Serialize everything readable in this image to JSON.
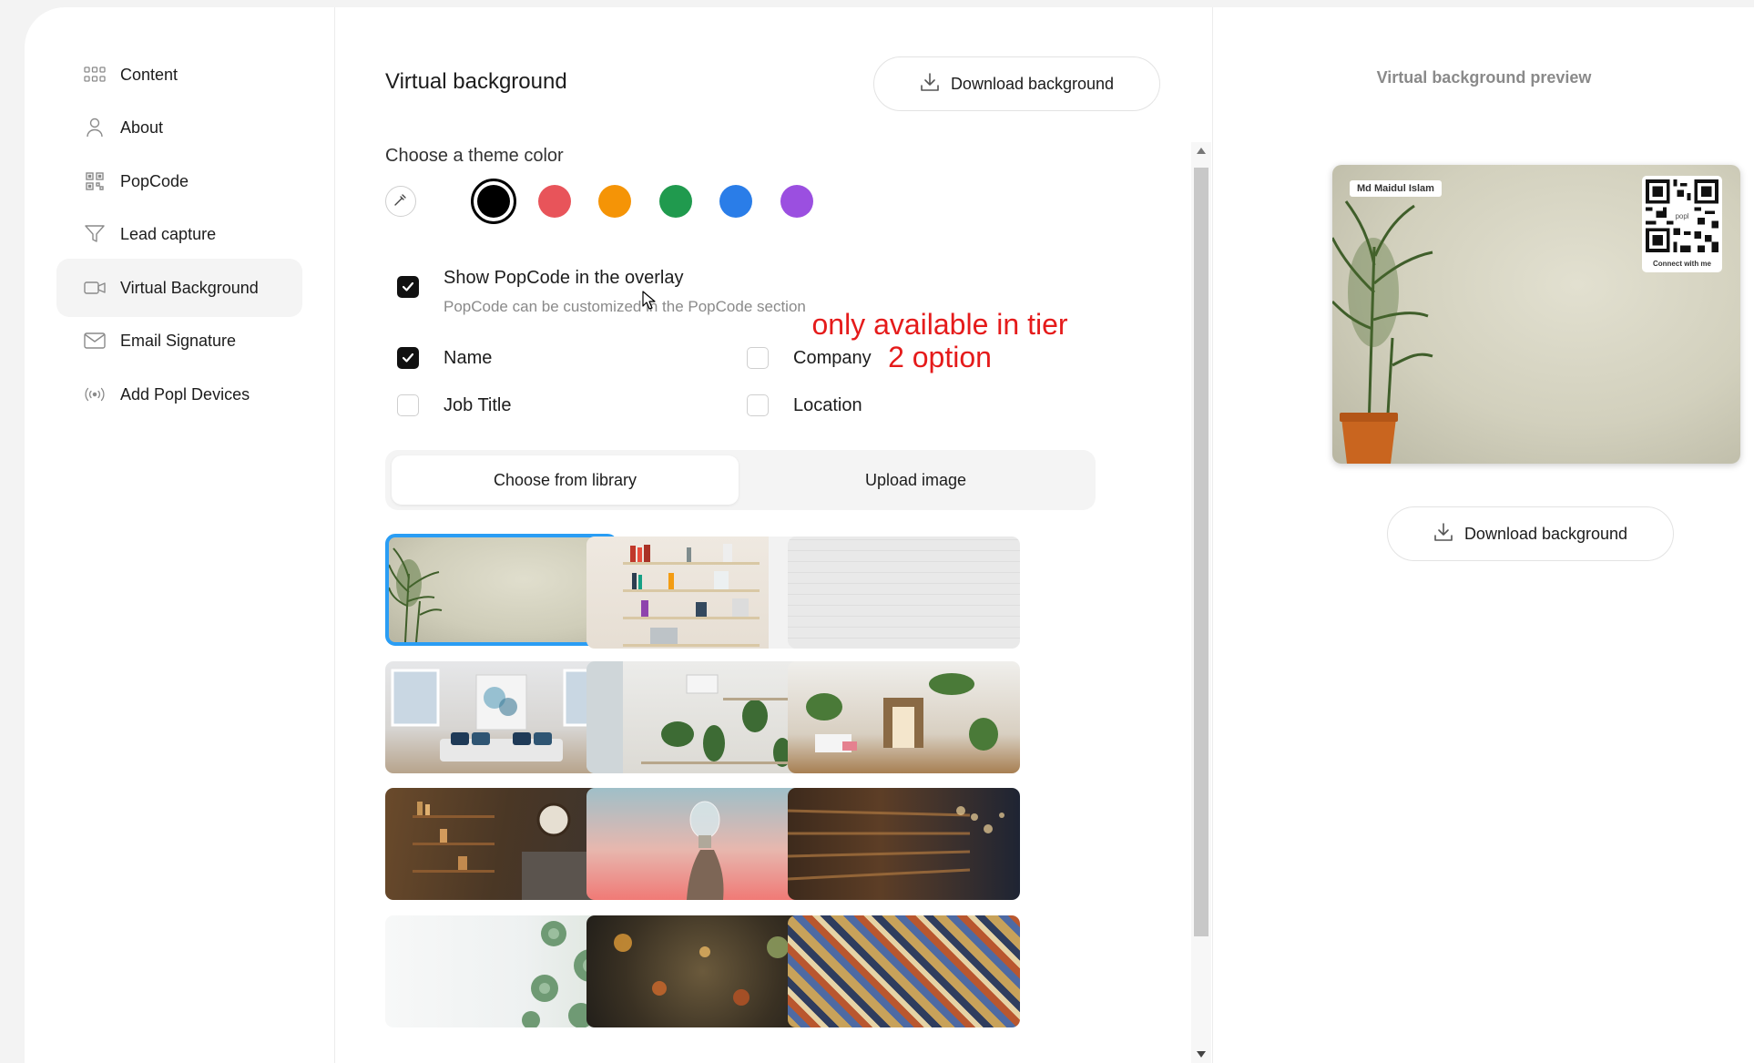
{
  "sidebar": {
    "items": [
      {
        "label": "Content",
        "icon": "grid-icon"
      },
      {
        "label": "About",
        "icon": "person-icon"
      },
      {
        "label": "PopCode",
        "icon": "qr-code-icon"
      },
      {
        "label": "Lead capture",
        "icon": "funnel-icon"
      },
      {
        "label": "Virtual Background",
        "icon": "video-camera-icon",
        "active": true
      },
      {
        "label": "Email Signature",
        "icon": "envelope-icon"
      },
      {
        "label": "Add Popl Devices",
        "icon": "broadcast-icon"
      }
    ]
  },
  "main": {
    "title": "Virtual background",
    "download_label": "Download background",
    "theme_label": "Choose a theme color",
    "colors": [
      {
        "name": "eyedropper",
        "hex": "#ffffff"
      },
      {
        "name": "black",
        "hex": "#000000",
        "selected": true
      },
      {
        "name": "red",
        "hex": "#e8545a"
      },
      {
        "name": "orange",
        "hex": "#f59406"
      },
      {
        "name": "green",
        "hex": "#209a4e"
      },
      {
        "name": "blue",
        "hex": "#2a7de8"
      },
      {
        "name": "purple",
        "hex": "#9b4fe0"
      }
    ],
    "show_popcode": {
      "label": "Show PopCode in the overlay",
      "sublabel": "PopCode can be customized in the PopCode section",
      "checked": true
    },
    "fields": {
      "name": {
        "label": "Name",
        "checked": true
      },
      "company": {
        "label": "Company",
        "checked": false
      },
      "job_title": {
        "label": "Job Title",
        "checked": false
      },
      "location": {
        "label": "Location",
        "checked": false
      }
    },
    "annotation": {
      "line1": "only available in tier",
      "line2": "2 option"
    },
    "tabs": [
      {
        "label": "Choose from library",
        "active": true
      },
      {
        "label": "Upload image",
        "active": false
      }
    ]
  },
  "preview": {
    "title": "Virtual background preview",
    "name_tag": "Md Maidul Islam",
    "qr_caption": "Connect with me",
    "qr_center": "popl",
    "download_label": "Download background"
  }
}
